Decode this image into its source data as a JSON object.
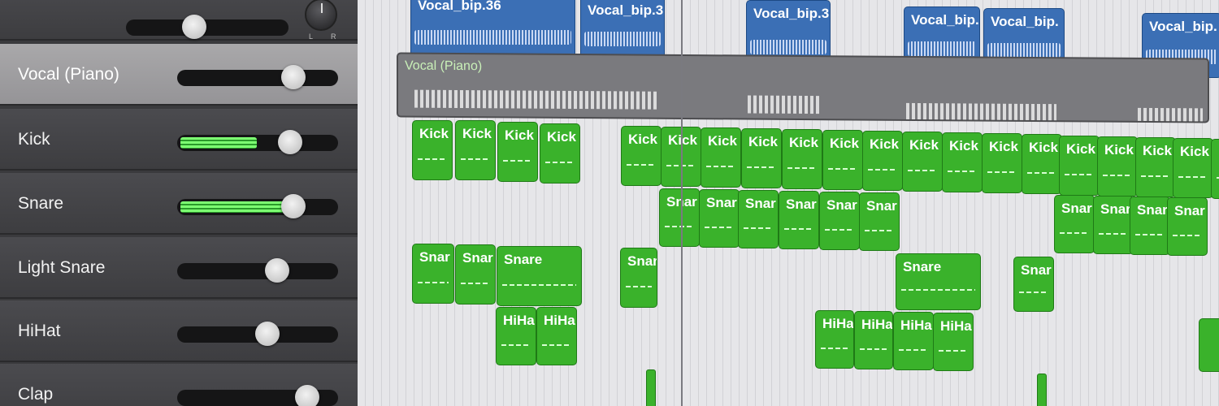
{
  "tracks": [
    {
      "name": "Vocal (Piano)",
      "volume": 0.72,
      "meter": 0,
      "selected": true
    },
    {
      "name": "Kick",
      "volume": 0.7,
      "meter": 0.55,
      "selected": false
    },
    {
      "name": "Snare",
      "volume": 0.72,
      "meter": 0.85,
      "selected": false
    },
    {
      "name": "Light Snare",
      "volume": 0.62,
      "meter": 0,
      "selected": false
    },
    {
      "name": "HiHat",
      "volume": 0.56,
      "meter": 0,
      "selected": false
    },
    {
      "name": "Clap",
      "volume": 0.81,
      "meter": 0,
      "selected": false
    }
  ],
  "top_track": {
    "volume": 0.42,
    "pan_left_label": "L",
    "pan_right_label": "R"
  },
  "vocal_regions": [
    "Vocal_bip.36",
    "Vocal_bip.3",
    "Vocal_bip.3",
    "Vocal_bip.",
    "Vocal_bip.",
    "Vocal_bip."
  ],
  "vocal_piano_region": "Vocal (Piano)",
  "kick_regions": [
    "Kick",
    "Kick",
    "Kick",
    "Kick",
    "Kick",
    "Kick",
    "Kick",
    "Kick",
    "Kick",
    "Kick",
    "Kick",
    "Kick",
    "Kick",
    "Kick",
    "Kick",
    "Kick",
    "Kick",
    "Kick",
    "Kick",
    "Kick"
  ],
  "snare_regions": [
    "Snar",
    "Snar",
    "Snar",
    "Snar",
    "Snar",
    "Snar",
    "Snar",
    "Snar",
    "Snar",
    "Snar"
  ],
  "light_snare_regions": [
    "Snar",
    "Snar",
    "Snare",
    "Snar",
    "Snare",
    "Snar"
  ],
  "hihat_regions": [
    "HiHa",
    "HiHa",
    "HiHa",
    "HiHa",
    "HiHa",
    "HiHa"
  ],
  "colors": {
    "region_green": "#3ab22b",
    "region_blue": "#3b6fb5",
    "selected_header": "#a9a8aa",
    "meter_green": "#7dff72"
  }
}
